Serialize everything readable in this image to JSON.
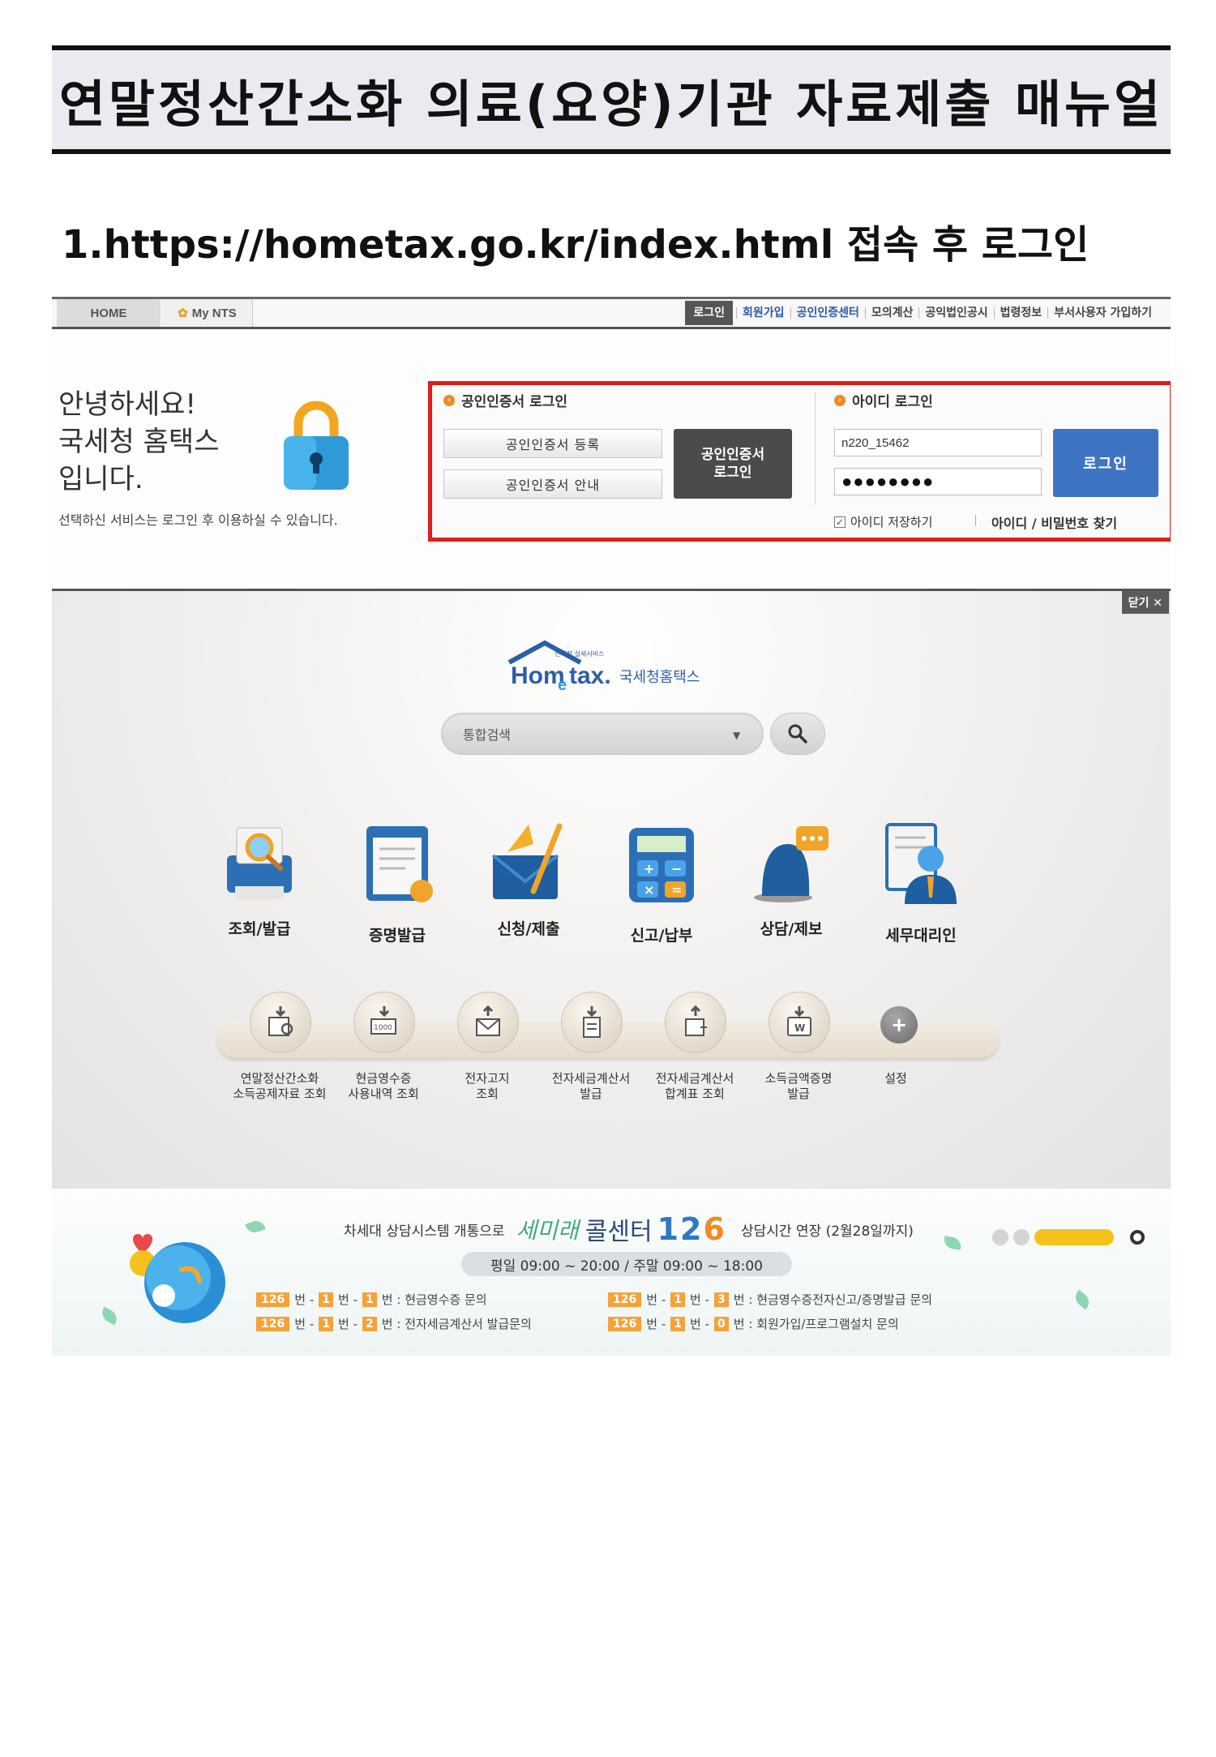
{
  "doc": {
    "title": "연말정산간소화 의료(요양)기관 자료제출 매뉴얼",
    "step1": "1.https://hometax.go.kr/index.html 접속 후 로그인"
  },
  "topbar": {
    "home_tab": "HOME",
    "mynts_tab": "My NTS",
    "links": [
      "로그인",
      "회원가입",
      "공인인증센터",
      "모의계산",
      "공익법인공시",
      "법령정보",
      "부서사용자 가입하기"
    ]
  },
  "welcome": {
    "line1": "안녕하세요!",
    "line2": "국세청 홈택스",
    "line3": "입니다.",
    "sub": "선택하신 서비스는 로그인 후 이용하실 수 있습니다."
  },
  "login": {
    "cert_title": "공인인증서 로그인",
    "cert_register": "공인인증서 등록",
    "cert_guide": "공인인증서 안내",
    "cert_login_line1": "공인인증서",
    "cert_login_line2": "로그인",
    "id_title": "아이디 로그인",
    "id_value": "n220_15462",
    "password_mask": "●●●●●●●●",
    "login_button": "로그인",
    "save_id": "아이디 저장하기",
    "save_id_checked": true,
    "find_link": "아이디 / 비밀번호 찾기",
    "highlight_color": "#e21b1b"
  },
  "hero": {
    "close": "닫기",
    "logo_small": "전자적 실세서비스",
    "logo_main": "Hometax.",
    "logo_kor": "국세청홈택스",
    "search_placeholder": "통합검색",
    "main_menu": [
      "조회/발급",
      "증명발급",
      "신청/제출",
      "신고/납부",
      "상담/제보",
      "세무대리인"
    ],
    "sub_menu": [
      {
        "line1": "연말정산간소화",
        "line2": "소득공제자료 조회"
      },
      {
        "line1": "현금영수증",
        "line2": "사용내역 조회"
      },
      {
        "line1": "전자고지",
        "line2": "조회"
      },
      {
        "line1": "전자세금계산서",
        "line2": "발급"
      },
      {
        "line1": "전자세금계산서",
        "line2": "합계표 조회"
      },
      {
        "line1": "소득금액증명",
        "line2": "발급"
      },
      {
        "line1": "설정",
        "line2": ""
      }
    ]
  },
  "banner": {
    "intro": "차세대 상담시스템 개통으로",
    "brand1": "세미래",
    "brand2": "콜센터",
    "number_a": "12",
    "number_b": "6",
    "extended": "상담시간 연장 (2월28일까지)",
    "hours": "평일 09:00 ~ 20:00 / 주말 09:00 ~ 18:00",
    "rows": [
      {
        "a": "126",
        "b": "1",
        "c": "1",
        "desc": "현금영수증 문의"
      },
      {
        "a": "126",
        "b": "1",
        "c": "3",
        "desc": "현금영수증전자신고/증명발급 문의"
      },
      {
        "a": "126",
        "b": "1",
        "c": "2",
        "desc": "전자세금계산서 발급문의"
      },
      {
        "a": "126",
        "b": "1",
        "c": "0",
        "desc": "회원가입/프로그램설치 문의"
      }
    ],
    "word_beon": "번",
    "dash": "-",
    "colon": ":"
  }
}
